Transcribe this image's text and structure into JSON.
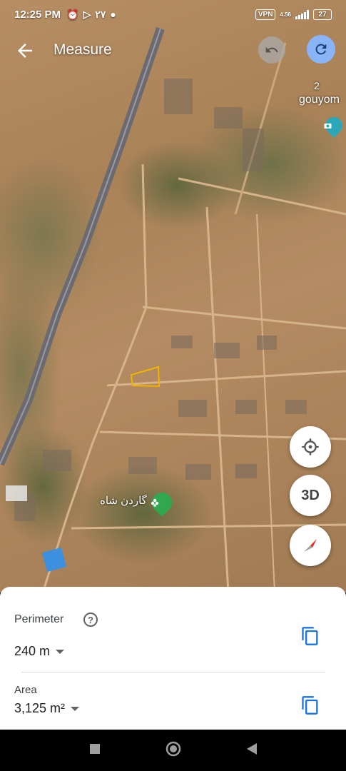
{
  "status_bar": {
    "time": "12:25 PM",
    "extra_text": "٢٧",
    "vpn": "VPN",
    "network_speed": "4.56",
    "battery": "27"
  },
  "top_bar": {
    "title": "Measure",
    "back_icon": "arrow-back-icon",
    "undo_icon": "undo-icon",
    "redo_icon": "redo-icon"
  },
  "map": {
    "poi_number": "2",
    "poi_label": "gouyom",
    "garden_label": "گاردن شاه",
    "controls": {
      "location_icon": "my-location-icon",
      "three_d_label": "3D",
      "compass_icon": "compass-icon"
    },
    "accent_blue": "#8ab4f8",
    "measure_outline": "#f0b400"
  },
  "measurement": {
    "perimeter_label": "Perimeter",
    "perimeter_value": "240 m",
    "area_label": "Area",
    "area_value": "3,125 m²",
    "copy_icon": "copy-icon",
    "help_icon": "help-icon"
  },
  "nav_bar": {
    "recents_icon": "square-icon",
    "home_icon": "circle-icon",
    "back_icon": "triangle-back-icon"
  }
}
